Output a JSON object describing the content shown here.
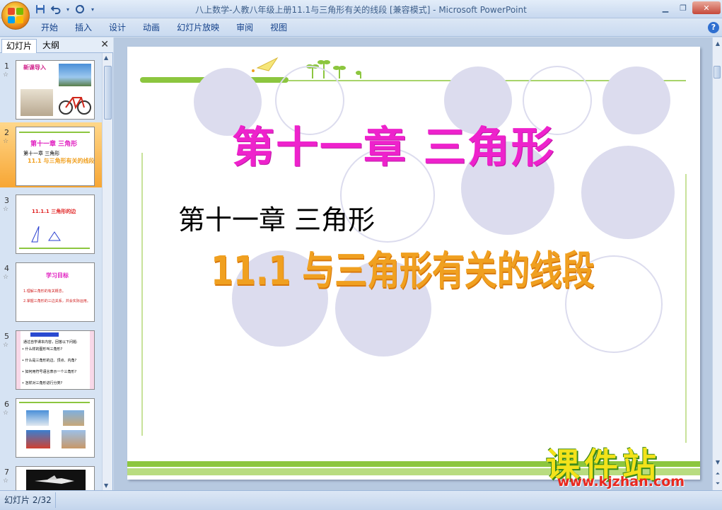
{
  "window": {
    "title": "八上数学-人教八年级上册11.1与三角形有关的线段 [兼容模式] - Microsoft PowerPoint"
  },
  "quick_access": {
    "save_icon": "save-icon",
    "undo_icon": "undo-icon",
    "redo_icon": "redo-icon",
    "customize_icon": "customize-icon"
  },
  "ribbon": {
    "tabs": [
      "开始",
      "插入",
      "设计",
      "动画",
      "幻灯片放映",
      "审阅",
      "视图"
    ],
    "help_label": "?"
  },
  "panel": {
    "tab_slides": "幻灯片",
    "tab_outline": "大纲",
    "close_glyph": "✕"
  },
  "thumbnails": [
    {
      "num": "1",
      "title": "新课导入"
    },
    {
      "num": "2",
      "title": "第十一章 三角形",
      "line2": "第十一章 三角形",
      "line3": "11.1 与三角形有关的线段"
    },
    {
      "num": "3",
      "title": "11.1.1 三角形的边"
    },
    {
      "num": "4",
      "title": "学习目标",
      "items": [
        "1.理解三角形的有关概念。",
        "2.掌握三角形的三边关系，并会实际运用。"
      ]
    },
    {
      "num": "5",
      "lines": [
        "通过自学课本内容，回答以下问题:",
        "• 什么样的图形叫三角形?",
        "• 什么是三角形的边、顶点、内角?",
        "• 如何用符号语言表示一个三角形?",
        "• 怎样对三角形进行分类?"
      ]
    },
    {
      "num": "6"
    },
    {
      "num": "7"
    }
  ],
  "slide": {
    "heading": "第十一章 三角形",
    "subheading": "第十一章 三角形",
    "title": "11.1 与三角形有关的线段"
  },
  "status": {
    "slide_indicator": "幻灯片 2/32"
  },
  "watermark": {
    "brand": "课件站",
    "url": "www.kjzhan.com"
  },
  "colors": {
    "heading": "#ee22cc",
    "title_top": "#ffee33",
    "title_bottom": "#ee7a10",
    "circle_fill": "#dcdcee",
    "green_bar": "#8cc63f",
    "selected_thumb": "#f7a634"
  }
}
